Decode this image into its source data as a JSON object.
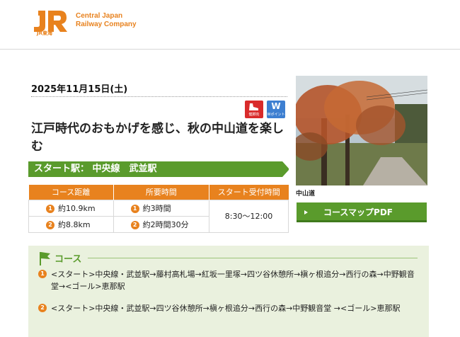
{
  "header": {
    "logo_mark": "JR",
    "logo_sub": "JR東海",
    "company_line1": "Central Japan",
    "company_line2": "Railway Company"
  },
  "event": {
    "date": "2025年11月15日(土)",
    "badges": [
      {
        "label": "健脚向",
        "icon": "walking-shoe-icon",
        "color": "#d92b2b"
      },
      {
        "label": "Wポイント",
        "icon": "w-point-icon",
        "color": "#3d7fd1",
        "glyph": "W"
      }
    ],
    "title": "江戸時代のおもかげを感じ、秋の中山道を楽しむ",
    "start_station": "スタート駅： 中央線　武並駅"
  },
  "table": {
    "headers": [
      "コース距離",
      "所要時間",
      "スタート受付時間"
    ],
    "rows": [
      {
        "num": "1",
        "distance": "約10.9km",
        "time_num": "1",
        "time": "約3時間"
      },
      {
        "num": "2",
        "distance": "約8.8km",
        "time_num": "2",
        "time": "約2時間30分"
      }
    ],
    "reception": "8:30〜12:00"
  },
  "photo": {
    "caption": "中山道"
  },
  "pdf_button": {
    "label": "コースマップPDF"
  },
  "course": {
    "title": "コース",
    "routes": [
      {
        "num": "1",
        "text": "<スタート>中央線・武並駅→藤村高札場→紅坂一里塚→四ツ谷休憩所→槇ヶ根追分→西行の森→中野観音堂→<ゴール>恵那駅"
      },
      {
        "num": "2",
        "text": "<スタート>中央線・武並駅→四ツ谷休憩所→槇ヶ根追分→西行の森→中野観音堂 →<ゴール>恵那駅"
      }
    ]
  },
  "colors": {
    "brand_orange": "#e8821e",
    "accent_green": "#5a9b2c",
    "panel_bg": "#eaf1de"
  }
}
